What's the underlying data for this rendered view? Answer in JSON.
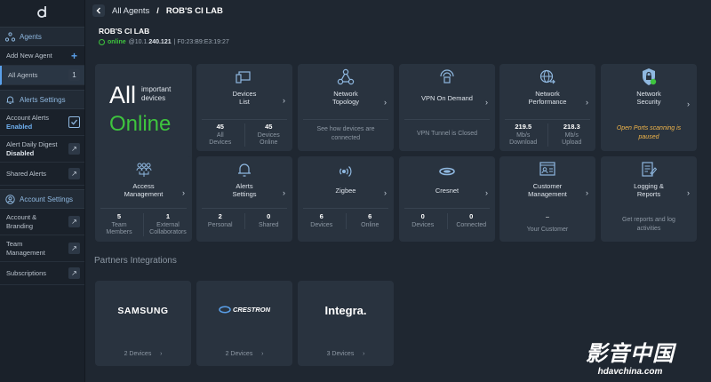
{
  "sidebar": {
    "agents_header": "Agents",
    "add_new_agent": "Add New Agent",
    "all_agents": "All Agents",
    "all_agents_count": "1",
    "alerts_header": "Alerts Settings",
    "account_alerts": "Account Alerts",
    "account_alerts_state": "Enabled",
    "daily_digest": "Alert Daily Digest",
    "daily_digest_state": "Disabled",
    "shared_alerts": "Shared Alerts",
    "account_header": "Account Settings",
    "account_branding": "Account &\nBranding",
    "team_management": "Team\nManagement",
    "subscriptions": "Subscriptions"
  },
  "breadcrumb": {
    "parent": "All Agents",
    "separator": "/",
    "current": "ROB'S CI LAB"
  },
  "agent": {
    "name": "ROB'S CI LAB",
    "status": "online",
    "ip_prefix": "@10.1.",
    "ip_bold": "240.121",
    "mac": "| F0:23:B9:E3:19:27"
  },
  "summary": {
    "all": "All",
    "important": "important\ndevices",
    "online": "Online"
  },
  "cards": {
    "devices_list": {
      "title": "Devices\nList",
      "s1n": "45",
      "s1l": "All\nDevices",
      "s2n": "45",
      "s2l": "Devices\nOnline"
    },
    "network_topology": {
      "title": "Network\nTopology",
      "note": "See how devices are\nconnected"
    },
    "vpn": {
      "title": "VPN On Demand",
      "note": "VPN Tunnel is Closed"
    },
    "network_performance": {
      "title": "Network\nPerformance",
      "s1n": "219.5",
      "s1l": "Mb/s\nDownload",
      "s2n": "218.3",
      "s2l": "Mb/s\nUpload"
    },
    "network_security": {
      "title": "Network\nSecurity",
      "note": "Open Ports scanning is\npaused"
    },
    "access_management": {
      "title": "Access\nManagement",
      "s1n": "5",
      "s1l": "Team\nMembers",
      "s2n": "1",
      "s2l": "External\nCollaborators"
    },
    "alerts_settings": {
      "title": "Alerts\nSettings",
      "s1n": "2",
      "s1l": "Personal",
      "s2n": "0",
      "s2l": "Shared"
    },
    "zigbee": {
      "title": "Zigbee",
      "s1n": "6",
      "s1l": "Devices",
      "s2n": "6",
      "s2l": "Online"
    },
    "cresnet": {
      "title": "Cresnet",
      "s1n": "0",
      "s1l": "Devices",
      "s2n": "0",
      "s2l": "Connected"
    },
    "customer_management": {
      "title": "Customer\nManagement",
      "dash": "–",
      "note": "Your Customer"
    },
    "logging_reports": {
      "title": "Logging &\nReports",
      "note": "Get reports and log\nactivities"
    }
  },
  "partners": {
    "title": "Partners Integrations",
    "items": [
      {
        "brand": "SAMSUNG",
        "devices": "2 Devices"
      },
      {
        "brand": "CRESTRON",
        "devices": "2 Devices"
      },
      {
        "brand": "Integra.",
        "devices": "3 Devices"
      }
    ]
  },
  "chevron": "›",
  "watermark": {
    "cn": "影音中国",
    "url": "hdavchina.com"
  },
  "colors": {
    "accent": "#5aa0ea",
    "online": "#3ec43e",
    "warning": "#f2b64a",
    "card": "#29333f",
    "background": "#1f2731"
  }
}
